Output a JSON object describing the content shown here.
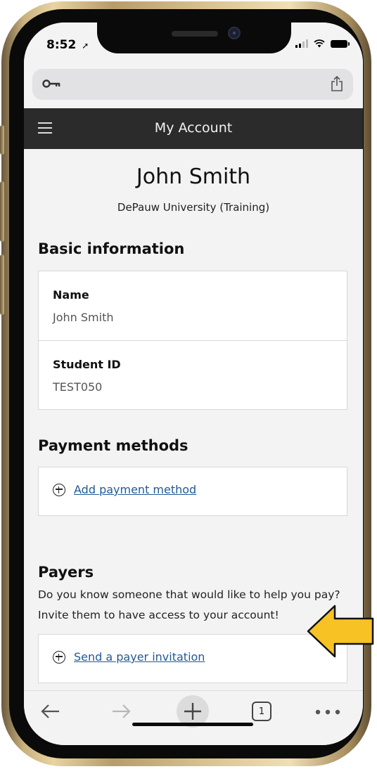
{
  "status_bar": {
    "time": "8:52"
  },
  "header": {
    "title": "My Account"
  },
  "profile": {
    "name": "John Smith",
    "organization": "DePauw University (Training)"
  },
  "basic_info": {
    "heading": "Basic information",
    "fields": [
      {
        "label": "Name",
        "value": "John Smith"
      },
      {
        "label": "Student ID",
        "value": "TEST050"
      }
    ]
  },
  "payment_methods": {
    "heading": "Payment methods",
    "add_label": "Add payment method"
  },
  "payers": {
    "heading": "Payers",
    "description": "Do you know someone that would like to help you pay? Invite them to have access to your account!",
    "invite_label": "Send a payer invitation"
  },
  "toolbar": {
    "tab_count": "1"
  },
  "colors": {
    "header_bg": "#2b2b2b",
    "link": "#1f5a96",
    "highlight_arrow": "#f7c324",
    "frame_gold": "#d9c190"
  }
}
